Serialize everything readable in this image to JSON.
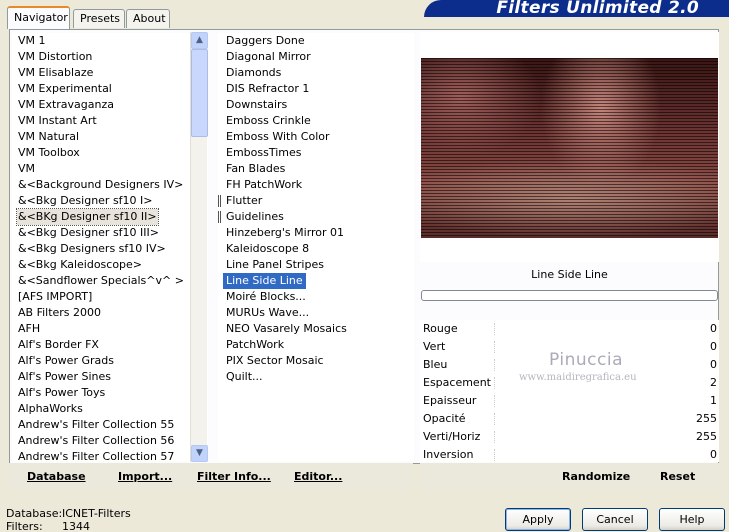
{
  "banner": {
    "title": "Filters Unlimited 2.0"
  },
  "tabs": [
    "Navigator",
    "Presets",
    "About"
  ],
  "categories": [
    "VM 1",
    "VM Distortion",
    "VM Elisablaze",
    "VM Experimental",
    "VM Extravaganza",
    "VM Instant Art",
    "VM Natural",
    "VM Toolbox",
    "VM",
    "&<Background Designers IV>",
    "&<Bkg Designer sf10 I>",
    "&<BKg Designer sf10 II>",
    "&<Bkg Designer sf10 III>",
    "&<Bkg Designers sf10 IV>",
    "&<Bkg Kaleidoscope>",
    "&<Sandflower Specials^v^ >",
    "[AFS IMPORT]",
    "AB Filters 2000",
    "AFH",
    "Alf's Border FX",
    "Alf's Power Grads",
    "Alf's Power Sines",
    "Alf's Power Toys",
    "AlphaWorks",
    "Andrew's Filter Collection 55",
    "Andrew's Filter Collection 56",
    "Andrew's Filter Collection 57"
  ],
  "selected_category": "&<BKg Designer sf10 II>",
  "filters": [
    "Daggers Done",
    "Diagonal Mirror",
    "Diamonds",
    "DIS Refractor 1",
    "Downstairs",
    "Emboss Crinkle",
    "Emboss With Color",
    "EmbossTimes",
    "Fan Blades",
    "FH PatchWork",
    "Flutter",
    "Guidelines",
    "Hinzeberg's Mirror 01",
    "Kaleidoscope 8",
    "Line Panel Stripes",
    "Line Side Line",
    "Moiré Blocks...",
    "MURUs Wave...",
    "NEO Vasarely Mosaics",
    "PatchWork",
    "PIX Sector Mosaic",
    "Quilt..."
  ],
  "selected_filter": "Line Side Line",
  "left_buttons": {
    "database": "Database",
    "import": "Import...",
    "filter_info": "Filter Info...",
    "editor": "Editor..."
  },
  "preview": {
    "filter_name": "Line Side Line"
  },
  "parameters": [
    {
      "label": "Rouge",
      "value": "0"
    },
    {
      "label": "Vert",
      "value": "0"
    },
    {
      "label": "Bleu",
      "value": "0"
    },
    {
      "label": "Espacement",
      "value": "2"
    },
    {
      "label": "Epaisseur",
      "value": "1"
    },
    {
      "label": "Opacité",
      "value": "255"
    },
    {
      "label": "Verti/Horiz",
      "value": "255"
    },
    {
      "label": "Inversion",
      "value": "0"
    }
  ],
  "right_buttons": {
    "randomize": "Randomize",
    "reset": "Reset"
  },
  "watermark": {
    "name": "Pinuccia",
    "site": "www.maidiregrafica.eu"
  },
  "status": {
    "database_label": "Database:",
    "database_value": "ICNET-Filters",
    "filters_label": "Filters:",
    "filters_value": "1344"
  },
  "dialog_buttons": {
    "apply": "Apply",
    "cancel": "Cancel",
    "help": "Help"
  }
}
